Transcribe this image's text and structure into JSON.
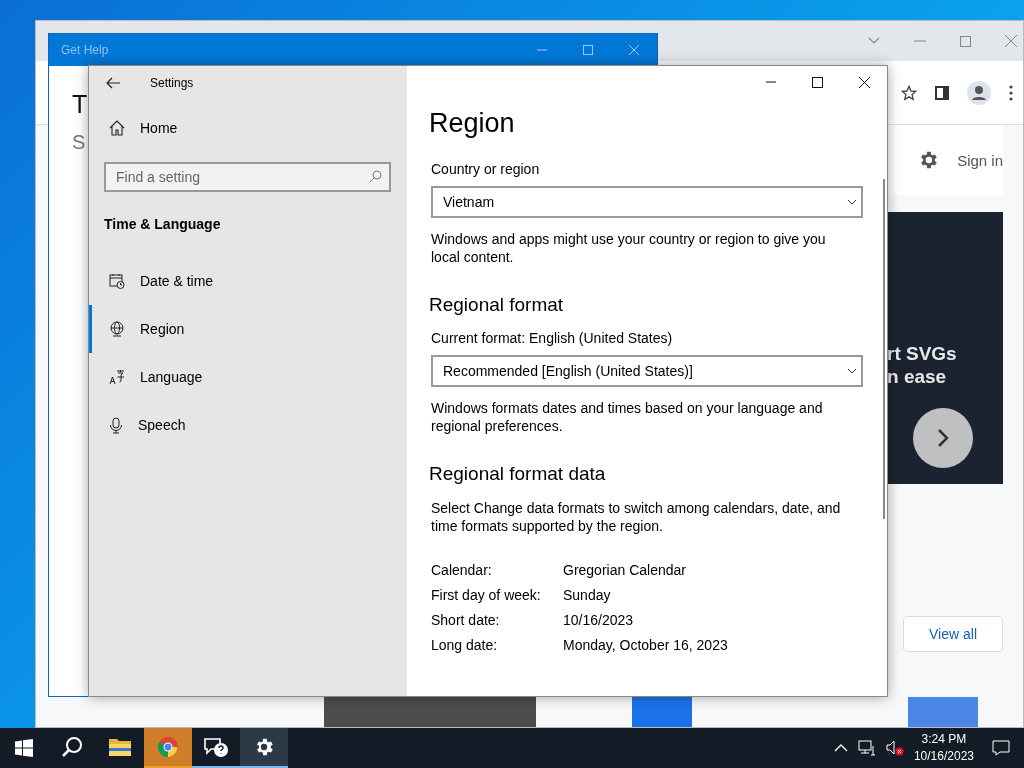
{
  "browser_window": {
    "sign_in": "Sign in",
    "banner_lines": [
      "rt SVGs",
      "n ease"
    ],
    "view_all": "View all"
  },
  "help_window": {
    "title": "Get Help",
    "heading": "T",
    "subheading": "S"
  },
  "settings_window": {
    "title": "Settings",
    "home": "Home",
    "search": {
      "placeholder": "Find a setting"
    },
    "section": "Time & Language",
    "nav_items": [
      {
        "kind": "calendar",
        "label": "Date & time",
        "selected": false
      },
      {
        "kind": "globe",
        "label": "Region",
        "selected": true
      },
      {
        "kind": "language",
        "label": "Language",
        "selected": false
      },
      {
        "kind": "microphone",
        "label": "Speech",
        "selected": false
      }
    ],
    "page": {
      "title": "Region",
      "country_label": "Country or region",
      "country_value": "Vietnam",
      "country_note": "Windows and apps might use your country or region to give you local content.",
      "format_heading": "Regional format",
      "format_label": "Current format: English (United States)",
      "format_value": "Recommended [English (United States)]",
      "format_note": "Windows formats dates and times based on your language and regional preferences.",
      "data_heading": "Regional format data",
      "data_note": "Select Change data formats to switch among calendars, date, and time formats supported by the region.",
      "data_rows": [
        {
          "label": "Calendar:",
          "value": "Gregorian Calendar"
        },
        {
          "label": "First day of week:",
          "value": "Sunday"
        },
        {
          "label": "Short date:",
          "value": "10/16/2023"
        },
        {
          "label": "Long date:",
          "value": "Monday, October 16, 2023"
        }
      ]
    }
  },
  "taskbar": {
    "apps": [
      {
        "kind": "search",
        "open": false,
        "flashing": false,
        "selected": false
      },
      {
        "kind": "folder",
        "open": false,
        "flashing": false,
        "selected": false
      },
      {
        "kind": "browser",
        "open": true,
        "flashing": true,
        "selected": false
      },
      {
        "kind": "help",
        "open": true,
        "flashing": false,
        "selected": false
      },
      {
        "kind": "settings",
        "open": true,
        "flashing": false,
        "selected": true
      }
    ],
    "time": "3:24 PM",
    "date": "10/16/2023"
  }
}
